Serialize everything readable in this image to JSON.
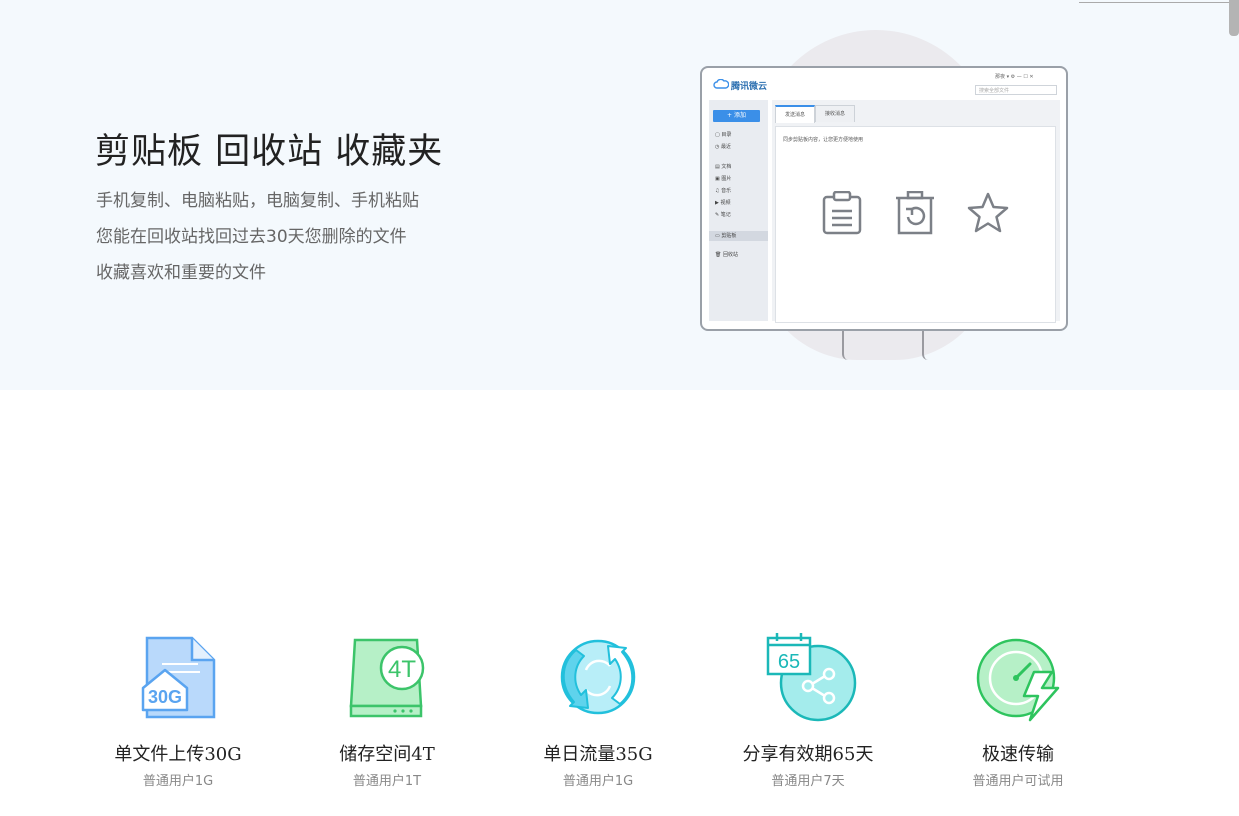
{
  "hero": {
    "title": "剪贴板 回收站 收藏夹",
    "lines": [
      "手机复制、电脑粘贴，电脑复制、手机粘贴",
      "您能在回收站找回过去30天您删除的文件",
      "收藏喜欢和重要的文件"
    ]
  },
  "app_preview": {
    "logo_text": "腾讯微云",
    "top_right": "那夜 ▾  ⚙ — ☐ ✕",
    "search_placeholder": "搜索全部文件",
    "add_button": "+ 添加",
    "sidebar": [
      {
        "label": "目录"
      },
      {
        "label": "最近"
      },
      {
        "label": "文档"
      },
      {
        "label": "图片"
      },
      {
        "label": "音乐"
      },
      {
        "label": "视频"
      },
      {
        "label": "笔记"
      },
      {
        "label": "剪贴板"
      },
      {
        "label": "回收站"
      }
    ],
    "tabs": [
      "发送消息",
      "接收消息"
    ],
    "tip": "同步剪贴板内容，让您更方便地使用",
    "icons": [
      "clipboard-icon",
      "recycle-bin-icon",
      "star-icon"
    ]
  },
  "features": [
    {
      "icon": "file-upload-icon",
      "badge": "30G",
      "title": "单文件上传30G",
      "sub": "普通用户1G",
      "color": "#5aa4f0"
    },
    {
      "icon": "storage-icon",
      "badge": "4T",
      "title": "储存空间4T",
      "sub": "普通用户1T",
      "color": "#3cc46a"
    },
    {
      "icon": "traffic-icon",
      "badge": "",
      "title": "单日流量35G",
      "sub": "普通用户1G",
      "color": "#22c0dc"
    },
    {
      "icon": "share-calendar-icon",
      "badge": "65",
      "title": "分享有效期65天",
      "sub": "普通用户7天",
      "color": "#1bb8b8"
    },
    {
      "icon": "speed-icon",
      "badge": "",
      "title": "极速传输",
      "sub": "普通用户可试用",
      "color": "#2ec45e"
    }
  ]
}
